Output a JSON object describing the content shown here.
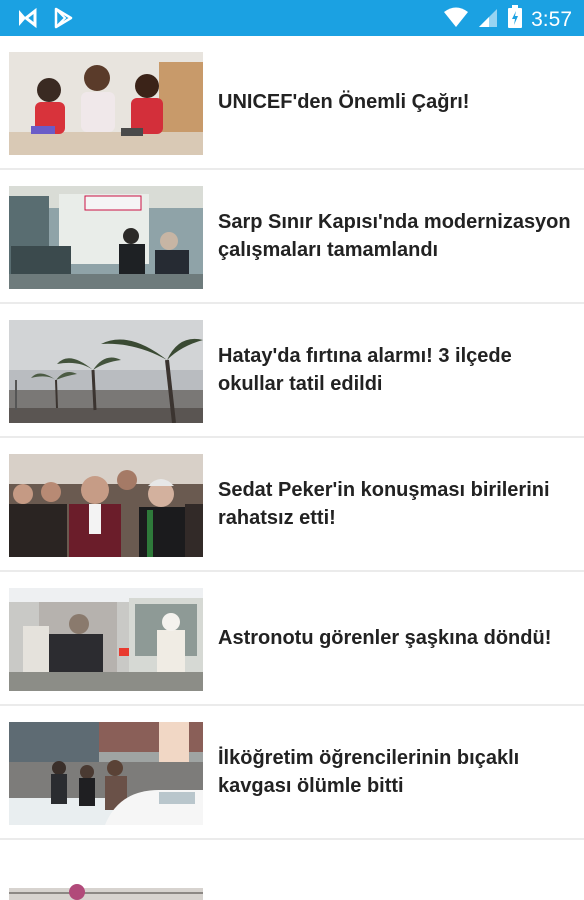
{
  "status_bar": {
    "time": "3:57",
    "left_icons": [
      "notification-app-icon",
      "play-store-icon"
    ],
    "right_icons": [
      "wifi-icon",
      "cellular-signal-icon",
      "battery-icon"
    ],
    "color": "#1ba1e2"
  },
  "feed": {
    "items": [
      {
        "title": "UNICEF'den Önemli Çağrı!",
        "image": "children-with-tablets-photo"
      },
      {
        "title": "Sarp Sınır Kapısı'nda modernizasyon çalışmaları tamamlandı",
        "image": "border-gate-photo"
      },
      {
        "title": "Hatay'da fırtına alarmı! 3 ilçede okullar tatil edildi",
        "image": "storm-palm-trees-photo"
      },
      {
        "title": "Sedat Peker'in konuşması birilerini rahatsız etti!",
        "image": "crowd-of-men-photo"
      },
      {
        "title": "Astronotu görenler şaşkına döndü!",
        "image": "astronaut-on-tram-photo"
      },
      {
        "title": "İlköğretim öğrencilerinin bıçaklı kavgası ölümle bitti",
        "image": "street-crowd-snow-photo"
      },
      {
        "title": "",
        "image": "partial-photo"
      }
    ]
  }
}
